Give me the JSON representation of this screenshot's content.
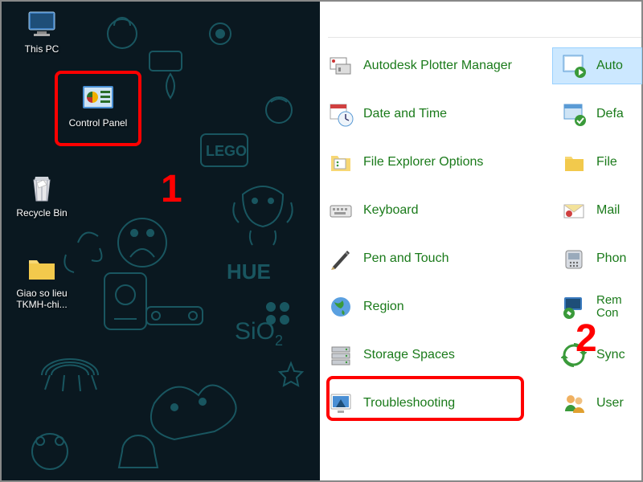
{
  "desktop": {
    "icons": [
      {
        "name": "this-pc",
        "label": "This PC"
      },
      {
        "name": "control-panel",
        "label": "Control Panel"
      },
      {
        "name": "recycle-bin",
        "label": "Recycle Bin"
      },
      {
        "name": "folder",
        "label": "Giao so lieu TKMH-chi..."
      }
    ]
  },
  "annotations": {
    "step1": "1",
    "step2": "2"
  },
  "control_panel": {
    "rows": [
      {
        "col1": {
          "id": "autodesk-plotter",
          "label": "Autodesk Plotter Manager"
        },
        "col2": {
          "id": "autoplay",
          "label": "Auto"
        }
      },
      {
        "col1": {
          "id": "date-time",
          "label": "Date and Time"
        },
        "col2": {
          "id": "default-programs",
          "label": "Defa"
        }
      },
      {
        "col1": {
          "id": "file-explorer-options",
          "label": "File Explorer Options"
        },
        "col2": {
          "id": "file-history",
          "label": "File "
        }
      },
      {
        "col1": {
          "id": "keyboard",
          "label": "Keyboard"
        },
        "col2": {
          "id": "mail",
          "label": "Mail"
        }
      },
      {
        "col1": {
          "id": "pen-touch",
          "label": "Pen and Touch"
        },
        "col2": {
          "id": "phone",
          "label": "Phon"
        }
      },
      {
        "col1": {
          "id": "region",
          "label": "Region"
        },
        "col2": {
          "id": "remote",
          "label": "Rem Con"
        }
      },
      {
        "col1": {
          "id": "storage-spaces",
          "label": "Storage Spaces"
        },
        "col2": {
          "id": "sync",
          "label": "Sync"
        }
      },
      {
        "col1": {
          "id": "troubleshooting",
          "label": "Troubleshooting"
        },
        "col2": {
          "id": "user-accounts",
          "label": "User"
        }
      }
    ]
  }
}
